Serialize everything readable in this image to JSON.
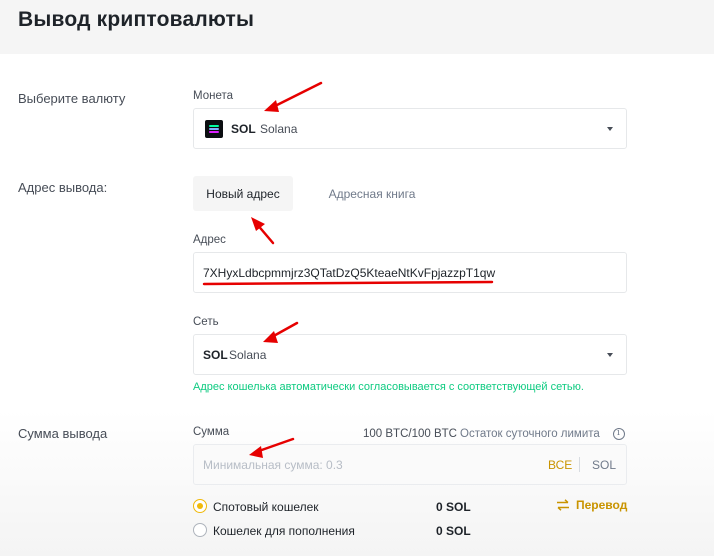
{
  "page": {
    "title": "Вывод криптовалюты"
  },
  "currency": {
    "section_label": "Выберите валюту",
    "field_label": "Монета",
    "selected_symbol": "SOL",
    "selected_name": "Solana",
    "icon": "solana-logo-icon"
  },
  "address": {
    "section_label": "Адрес вывода:",
    "tabs": [
      {
        "label": "Новый адрес",
        "active": true
      },
      {
        "label": "Адресная книга",
        "active": false
      }
    ],
    "field_label": "Адрес",
    "value": "7XHyxLdbcpmmjrz3QTatDzQ5KteaeNtKvFpjazzpT1qw"
  },
  "network": {
    "field_label": "Сеть",
    "selected_symbol": "SOL",
    "selected_name": "Solana",
    "hint": "Адрес кошелька автоматически согласовывается с соответствующей сетью."
  },
  "amount": {
    "section_label": "Сумма вывода",
    "field_label": "Сумма",
    "limit_value": "100 BTC/100 BTC",
    "limit_label": "Остаток суточного лимита",
    "placeholder": "Минимальная сумма: 0.3",
    "all_button": "ВСЕ",
    "unit": "SOL"
  },
  "wallets": [
    {
      "label": "Спотовый кошелек",
      "balance": "0 SOL",
      "selected": true
    },
    {
      "label": "Кошелек для пополнения",
      "balance": "0 SOL",
      "selected": false
    }
  ],
  "transfer_label": "Перевод",
  "colors": {
    "accent": "#f0b90b",
    "success": "#0ecb81",
    "annotation": "#e60000"
  }
}
